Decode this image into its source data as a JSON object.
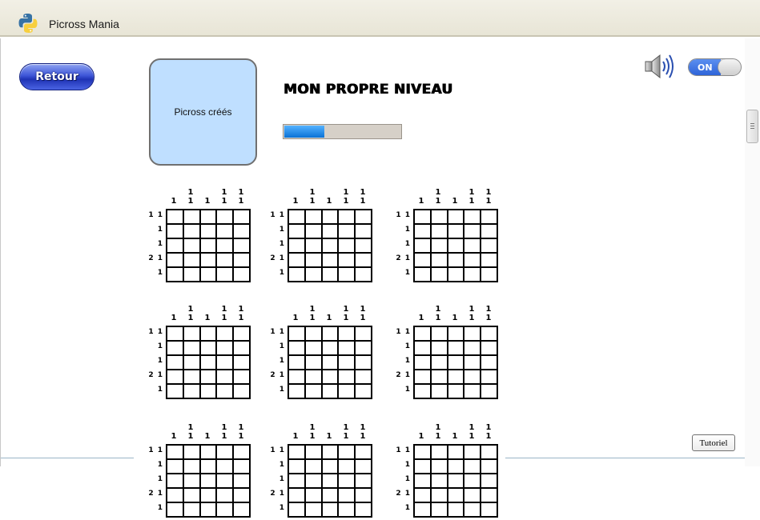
{
  "window": {
    "title": "Picross Mania",
    "icon": "python-logo-icon"
  },
  "header": {
    "back_label": "Retour",
    "created_box_label": "Picross créés",
    "title": "MON PROPRE NIVEAU",
    "progress_fraction": 0.34
  },
  "sound": {
    "icon": "speaker-icon",
    "toggle_label": "ON",
    "enabled": true
  },
  "puzzles": {
    "col_clues": [
      [
        "1"
      ],
      [
        "1",
        "1"
      ],
      [
        "1"
      ],
      [
        "1",
        "1"
      ],
      [
        "1",
        "1"
      ]
    ],
    "row_clues": [
      "1 1",
      "1",
      "1",
      "2 1",
      "1"
    ],
    "count": 9
  },
  "footer": {
    "tutorial_label": "Tutoriel"
  }
}
